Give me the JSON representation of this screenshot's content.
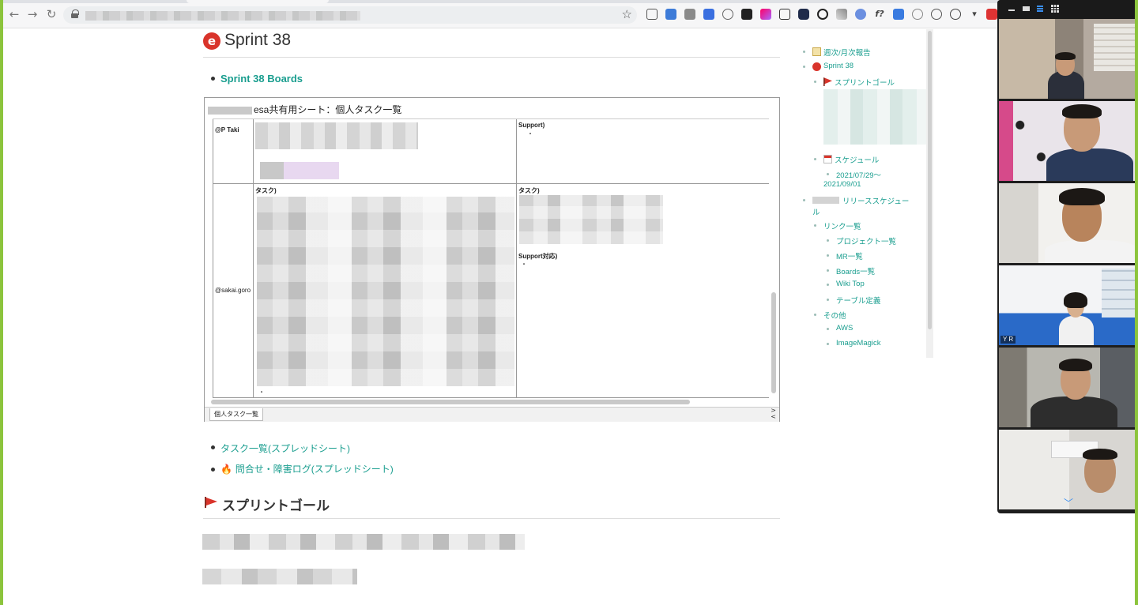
{
  "browser": {
    "back_icon": "←",
    "forward_icon": "→",
    "reload_icon": "↻",
    "star_icon": "☆"
  },
  "page": {
    "title": "Sprint 38",
    "logo_glyph": "e",
    "links": [
      {
        "label": "Sprint 38 Boards"
      },
      {
        "label": "タスク一覧(スプレッドシート)"
      },
      {
        "label": "問合せ・障害ログ(スプレッドシート)",
        "emoji": "🔥"
      }
    ],
    "section_heading": "スプリントゴール"
  },
  "sheet": {
    "title": "esa共有用シート：個人タスク一覧",
    "rows": [
      {
        "user": "@P Taki",
        "col2_header": "",
        "col3_header": "Support)",
        "col3_note": "・"
      },
      {
        "user": "@sakai.goro",
        "col2_header": "タスク)",
        "col2_note": "・",
        "col3_header": "タスク)",
        "col3_sub": "Support対応)",
        "col3_note": "・"
      }
    ],
    "tab_label": "個人タスク一覧",
    "arrow_right": ">",
    "arrow_left": "<"
  },
  "toc": {
    "items": [
      {
        "label": "週次/月次報告",
        "level": 1,
        "icon": "memo-icon"
      },
      {
        "label": "Sprint 38",
        "level": 1,
        "icon": "esa-logo-icon"
      },
      {
        "label": "スプリントゴール",
        "level": 2,
        "icon": "flag-icon"
      },
      {
        "label": "スケジュール",
        "level": 2,
        "icon": "calendar-icon"
      },
      {
        "label": "2021/07/29～",
        "level": 3
      },
      {
        "label": "2021/09/01",
        "level": 3
      },
      {
        "label": "リリーススケジュー",
        "level": 1
      },
      {
        "label": "ル",
        "level": 1
      },
      {
        "label": "リンク一覧",
        "level": 2
      },
      {
        "label": "プロジェクト一覧",
        "level": 3
      },
      {
        "label": "MR一覧",
        "level": 3
      },
      {
        "label": "Boards一覧",
        "level": 3
      },
      {
        "label": "Wiki Top",
        "level": 3
      },
      {
        "label": "テーブル定義",
        "level": 3
      },
      {
        "label": "その他",
        "level": 2
      },
      {
        "label": "AWS",
        "level": 3
      },
      {
        "label": "ImageMagick",
        "level": 3
      }
    ]
  },
  "zoom": {
    "participant_initials": "Y R",
    "scroll_down_icon": "﹀"
  },
  "colors": {
    "link": "#1a9e8f",
    "esa_red": "#d9342b",
    "desktop_green": "#8cc43c",
    "zoom_active": "#c7d94f"
  }
}
